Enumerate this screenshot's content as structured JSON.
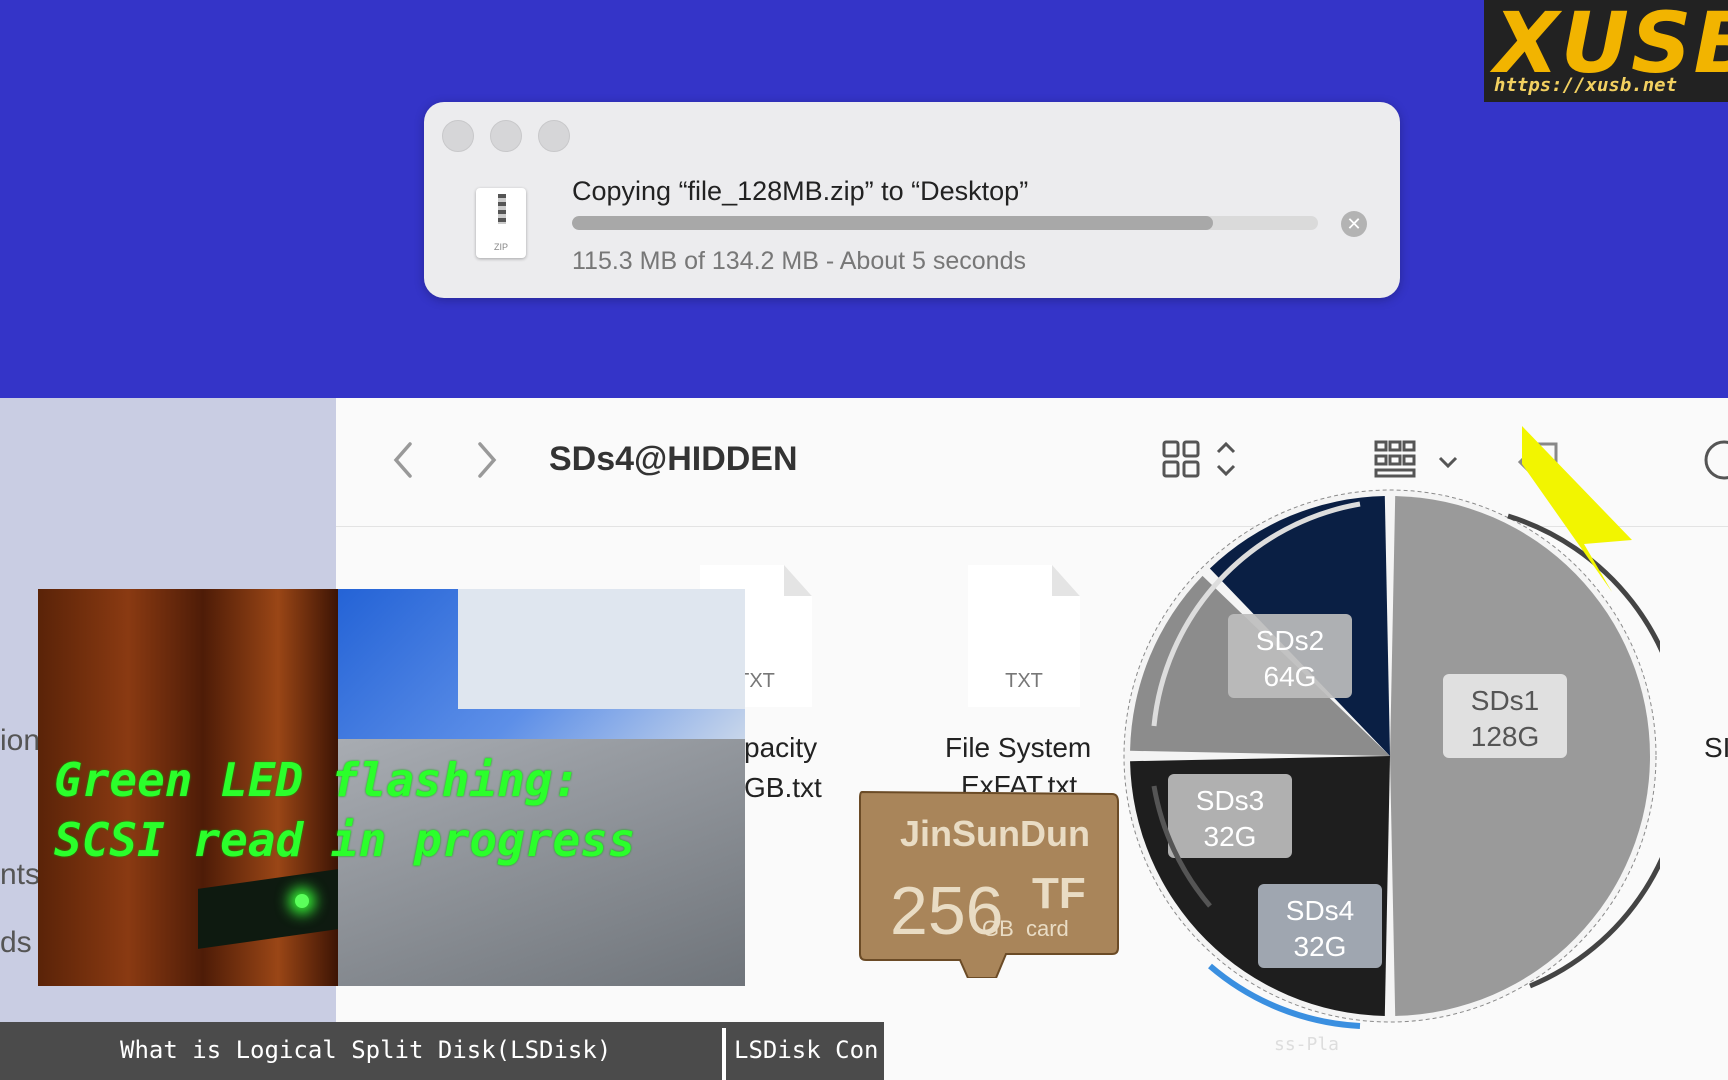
{
  "logo": {
    "title": "XUSB",
    "url": "https://xusb.net"
  },
  "copy_dialog": {
    "title": "Copying “file_128MB.zip” to “Desktop”",
    "status": "115.3 MB of 134.2 MB - About 5 seconds",
    "progress_fraction": 0.859,
    "file_icon_label": "ZIP"
  },
  "finder": {
    "folder_title": "SDs4@HIDDEN",
    "sidebar_fragments": [
      "ion",
      "nts",
      "ds"
    ],
    "files": [
      {
        "ext": "TXT",
        "name_line1": "pacity",
        "name_line2": "GB.txt"
      },
      {
        "ext": "TXT",
        "name_line1": "File System",
        "name_line2": "ExFAT.txt"
      }
    ],
    "right_edge_text": "SI"
  },
  "video_overlay": {
    "caption_line1": "Green LED flashing:",
    "caption_line2": "SCSI read in progress"
  },
  "sd_card": {
    "brand": "JinSunDun",
    "capacity": "256",
    "unit": "GB",
    "type": "TF",
    "sub": "card"
  },
  "pie": {
    "partitions": [
      {
        "name": "SDs1",
        "size": "128G",
        "fraction": 0.5,
        "color": "#9a9a9a"
      },
      {
        "name": "SDs2",
        "size": "64G",
        "fraction": 0.25,
        "color": "#1e1e1e"
      },
      {
        "name": "SDs3",
        "size": "32G",
        "fraction": 0.125,
        "color": "#8c8c8c"
      },
      {
        "name": "SDs4",
        "size": "32G",
        "fraction": 0.125,
        "color": "#0a1f44"
      }
    ],
    "footer_fragment": "ss-Pla"
  },
  "banner": {
    "item1": "What is Logical Split Disk(LSDisk)",
    "item2": "LSDisk Con"
  },
  "colors": {
    "background_blue": "#3434c8",
    "cursor": "#f2f500",
    "led_text": "#2bff2b",
    "logo": "#f2b400"
  }
}
